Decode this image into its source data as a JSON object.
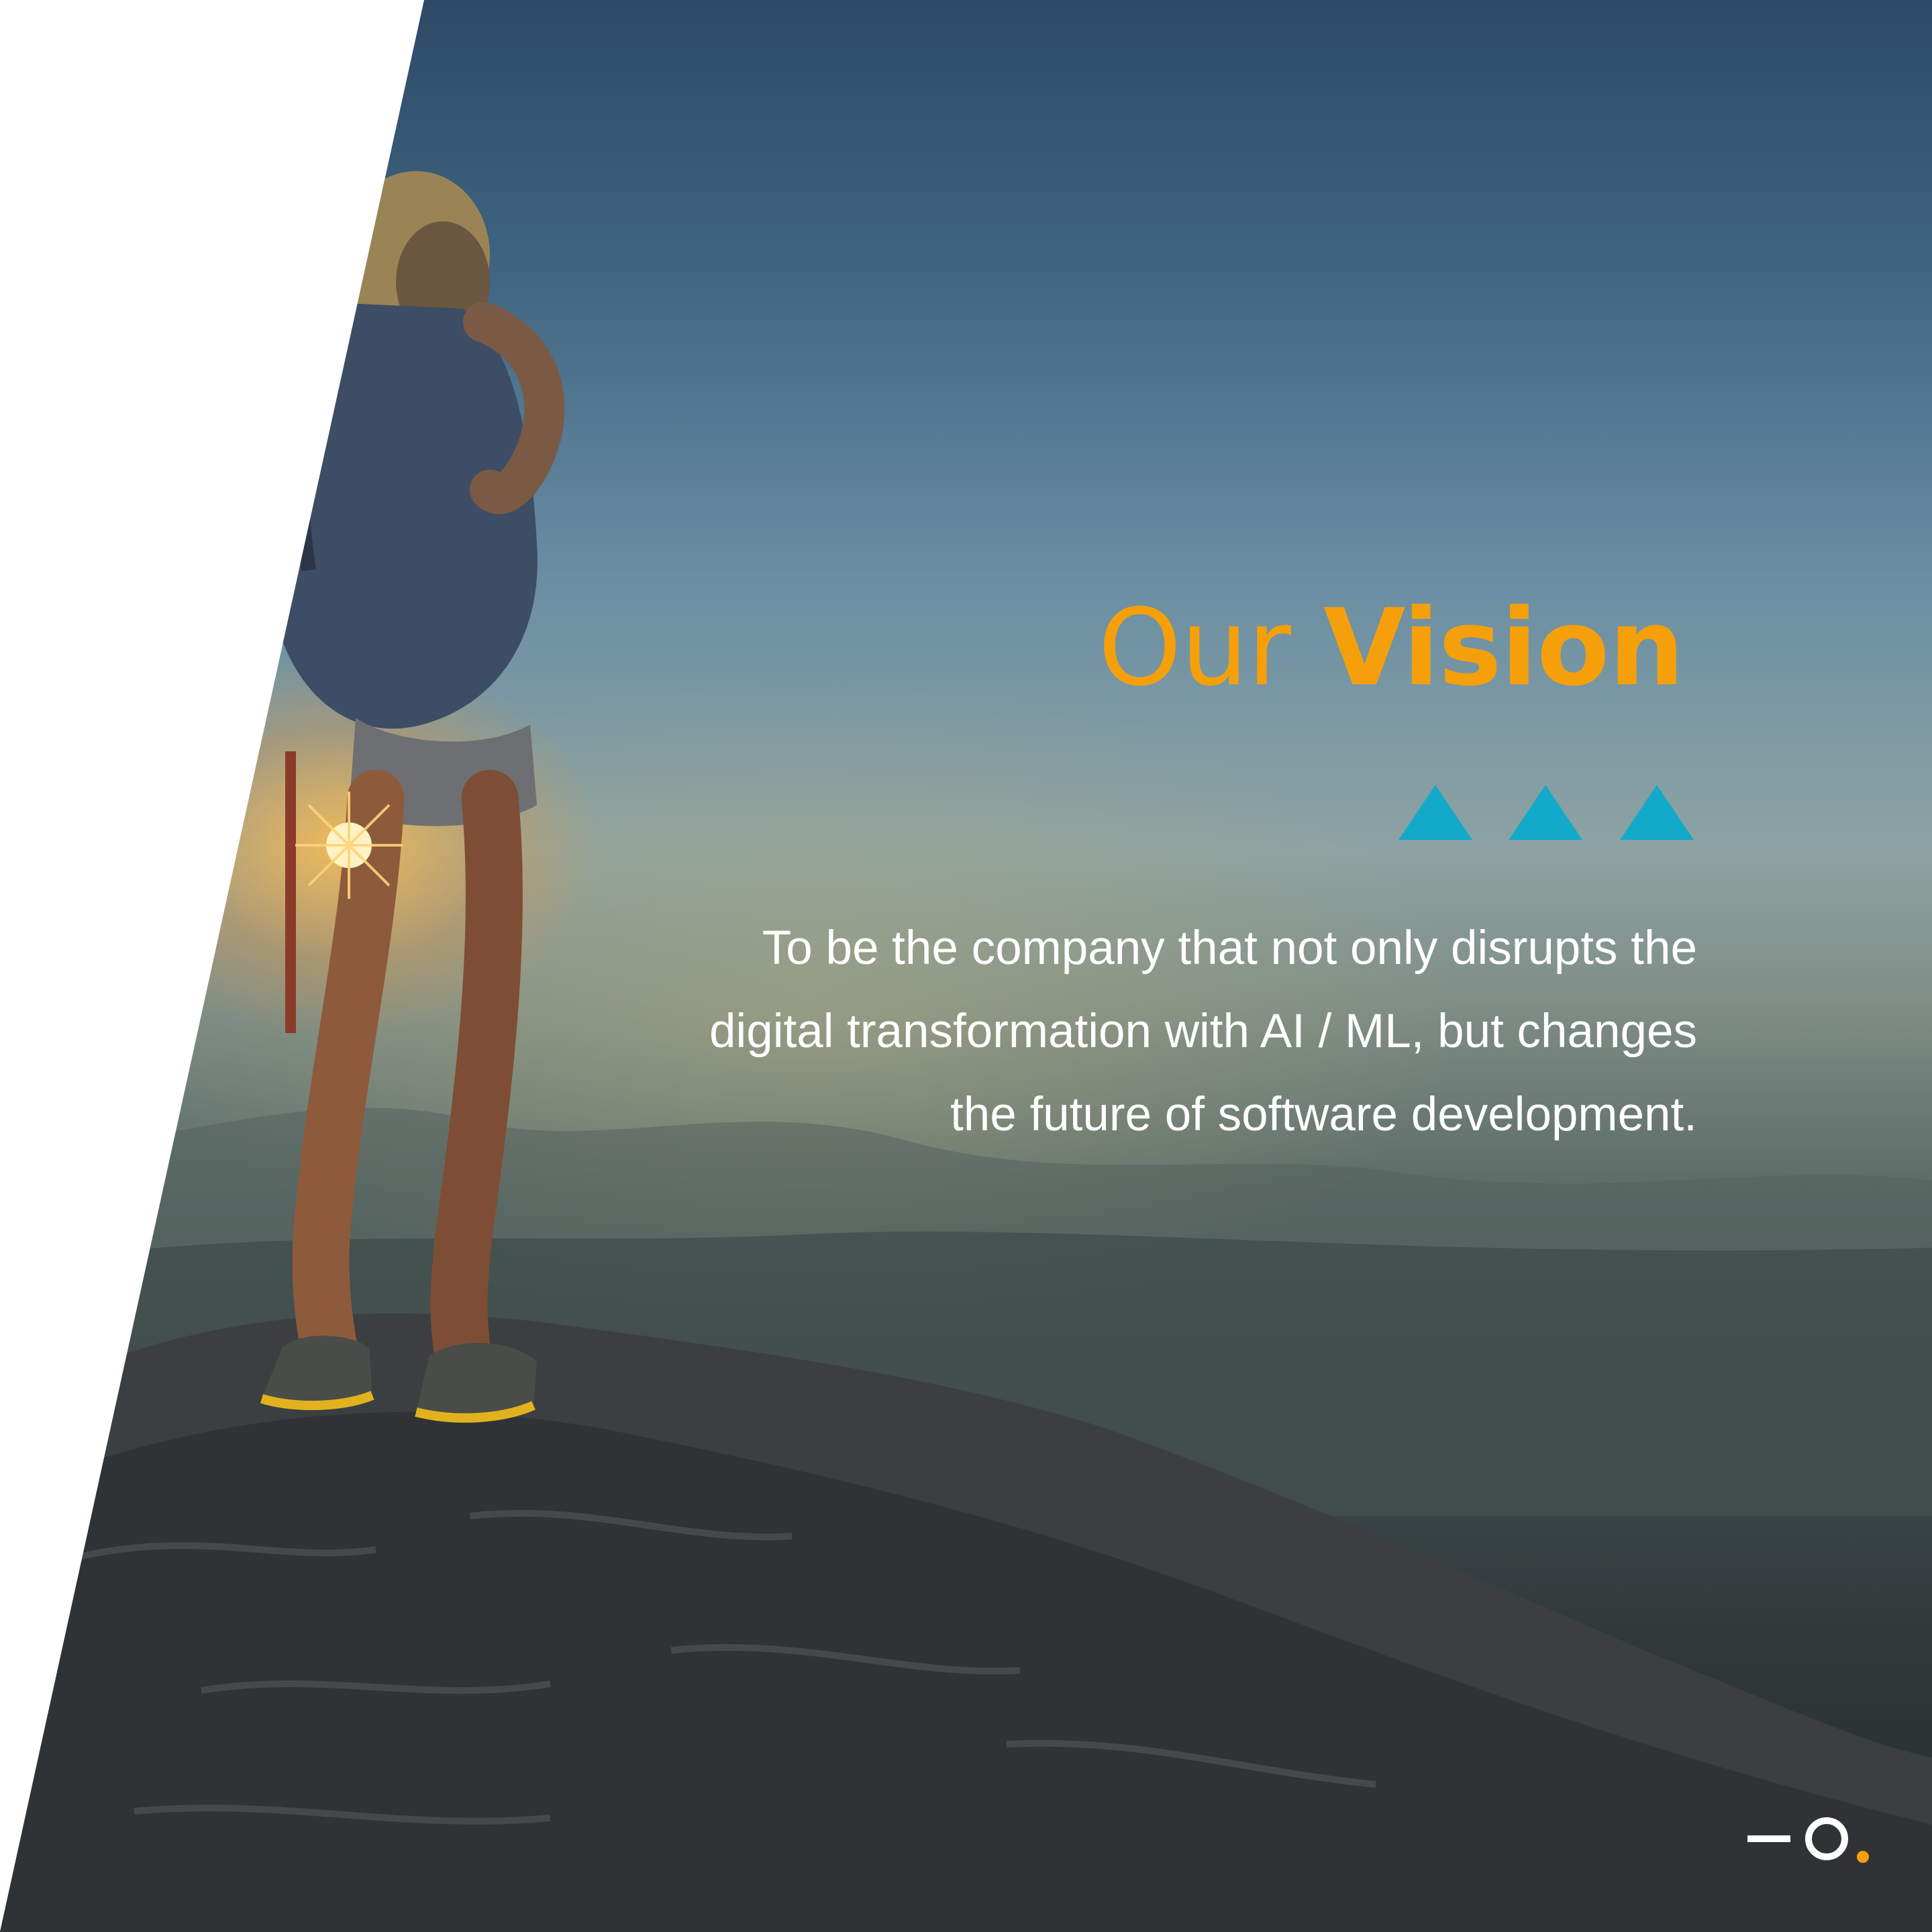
{
  "heading": {
    "light": "Our ",
    "bold": "Vision"
  },
  "body": {
    "line1": "To be the company that not only disrupts the",
    "line2": "digital transformation with AI / ML, but changes",
    "line3": "the future of software development."
  },
  "colors": {
    "accent_orange": "#f5a00b",
    "accent_cyan": "#13a9c9",
    "text_white": "#ffffff",
    "background_white": "#ffffff"
  },
  "icons": {
    "triangles": "three-up-triangles-icon",
    "logo": "dash-circle-dot-logo"
  }
}
